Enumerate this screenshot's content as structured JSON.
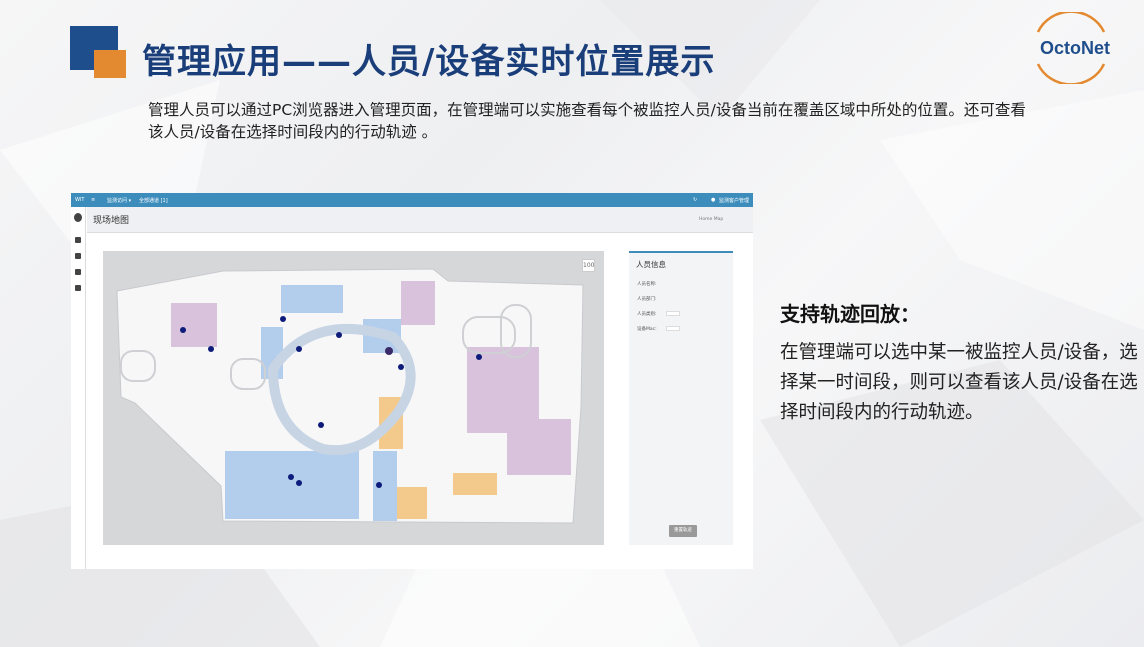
{
  "slide": {
    "title": "管理应用——人员/设备实时位置展示",
    "logo_text": "OctoNet",
    "intro": "管理人员可以通过PC浏览器进入管理页面，在管理端可以实施查看每个被监控人员/设备当前在覆盖区域中所处的位置。还可查看该人员/设备在选择时间段内的行动轨迹 。",
    "right_title": "支持轨迹回放：",
    "right_text": "在管理端可以选中某一被监控人员/设备，选择某一时间段，则可以查看该人员/设备在选择时间段内的行动轨迹。"
  },
  "screenshot": {
    "brand": "WIT",
    "menu_item_1": "监测访问 ▾",
    "menu_item_2": "全部通道  [1]",
    "user_label": "监测客户管理",
    "page_title": "现场地图",
    "breadcrumb": "Home   Map",
    "zoom_label": "100",
    "panel_title": "人员信息",
    "fields": [
      "人员名称:",
      "人员部门:",
      "人员类别:",
      "设备Mac:"
    ],
    "reset_button": "重置轨迹"
  },
  "colors": {
    "title_blue": "#1a3e7a",
    "accent_orange": "#e3892f",
    "topbar": "#3c8dbc",
    "marker": "#0d1b7a",
    "area_blue": "#b3cdec",
    "area_orange": "#f3ca8c",
    "area_purple": "#d9c3dc"
  }
}
